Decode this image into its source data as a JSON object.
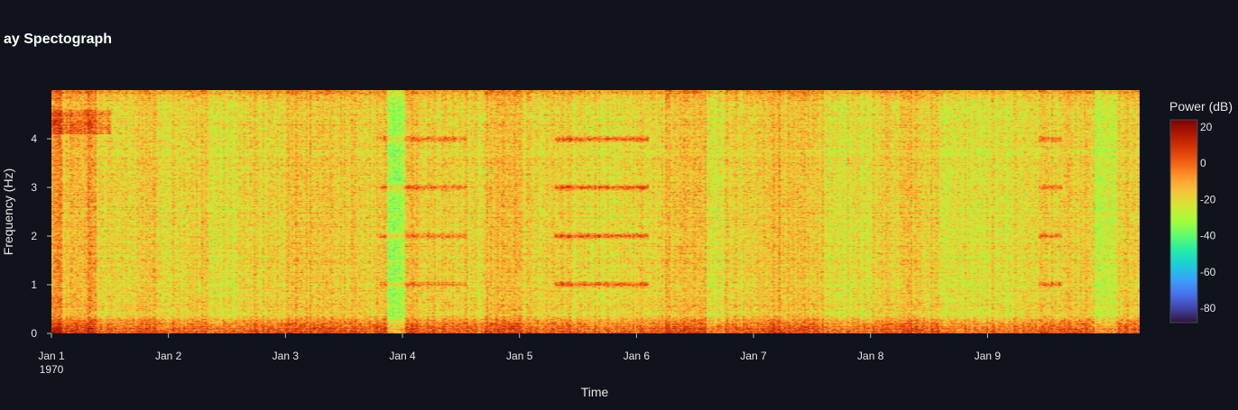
{
  "chart_data": {
    "type": "heatmap",
    "title": "ay Spectograph",
    "xlabel": "Time",
    "ylabel": "Frequency (Hz)",
    "x_range": [
      "1970-01-01",
      "1970-01-09 23:00"
    ],
    "x_ticks": [
      "Jan 1",
      "Jan 2",
      "Jan 3",
      "Jan 4",
      "Jan 5",
      "Jan 6",
      "Jan 7",
      "Jan 8",
      "Jan 9"
    ],
    "x_tick_sublabel": "1970",
    "ylim": [
      0,
      5
    ],
    "y_ticks": [
      0,
      1,
      2,
      3,
      4
    ],
    "colorbar": {
      "title": "Power (dB)",
      "range": [
        -88,
        24
      ],
      "ticks": [
        20,
        0,
        -20,
        -40,
        -60,
        -80
      ],
      "colorscale": [
        "#30123b",
        "#4145ab",
        "#4675ed",
        "#39a2fc",
        "#1bcfd4",
        "#24eca6",
        "#61fc6c",
        "#a4fc3b",
        "#d1e834",
        "#f3c63a",
        "#fe9b2d",
        "#f36315",
        "#d93806",
        "#b11901",
        "#7a0402"
      ]
    },
    "grid": false,
    "segments": [
      {
        "start": 0.0,
        "end": 0.08,
        "base": -7
      },
      {
        "start": 0.08,
        "end": 0.3,
        "base": -14
      },
      {
        "start": 0.3,
        "end": 0.38,
        "base": -9
      },
      {
        "start": 0.38,
        "end": 0.6,
        "base": -19
      },
      {
        "start": 0.6,
        "end": 0.9,
        "base": -16
      },
      {
        "start": 0.9,
        "end": 1.0,
        "base": -20
      },
      {
        "start": 1.0,
        "end": 1.35,
        "base": -18
      },
      {
        "start": 1.35,
        "end": 1.6,
        "base": -21
      },
      {
        "start": 1.6,
        "end": 2.0,
        "base": -18
      },
      {
        "start": 2.0,
        "end": 2.6,
        "base": -16
      },
      {
        "start": 2.6,
        "end": 2.75,
        "base": -18
      },
      {
        "start": 2.75,
        "end": 2.87,
        "base": -14
      },
      {
        "start": 2.87,
        "end": 3.02,
        "base": -32
      },
      {
        "start": 3.02,
        "end": 3.3,
        "base": -16
      },
      {
        "start": 3.3,
        "end": 3.7,
        "base": -18
      },
      {
        "start": 3.7,
        "end": 4.02,
        "base": -12
      },
      {
        "start": 4.02,
        "end": 4.45,
        "base": -17
      },
      {
        "start": 4.45,
        "end": 5.0,
        "base": -20
      },
      {
        "start": 5.0,
        "end": 5.25,
        "base": -17
      },
      {
        "start": 5.25,
        "end": 5.6,
        "base": -14
      },
      {
        "start": 5.6,
        "end": 5.75,
        "base": -22
      },
      {
        "start": 5.75,
        "end": 6.0,
        "base": -18
      },
      {
        "start": 6.0,
        "end": 6.6,
        "base": -15
      },
      {
        "start": 6.6,
        "end": 7.0,
        "base": -20
      },
      {
        "start": 7.0,
        "end": 7.6,
        "base": -17
      },
      {
        "start": 7.6,
        "end": 8.0,
        "base": -22
      },
      {
        "start": 8.0,
        "end": 8.45,
        "base": -20
      },
      {
        "start": 8.45,
        "end": 8.92,
        "base": -17
      },
      {
        "start": 8.92,
        "end": 9.1,
        "base": -26
      },
      {
        "start": 9.1,
        "end": 9.3,
        "base": -18
      }
    ],
    "harmonic_bands": [
      {
        "start": 2.8,
        "end": 3.55,
        "freqs": [
          1,
          2,
          3,
          4
        ],
        "strength": 16
      },
      {
        "start": 4.3,
        "end": 5.1,
        "freqs": [
          1,
          2,
          3,
          4
        ],
        "strength": 24
      },
      {
        "start": 8.45,
        "end": 8.65,
        "freqs": [
          1,
          2,
          3,
          4
        ],
        "strength": 18
      }
    ],
    "low_freq_band": {
      "freq_max": 0.35,
      "strength": 18
    },
    "high_freq_band": {
      "freq_min": 4.75,
      "strength": 10
    }
  }
}
